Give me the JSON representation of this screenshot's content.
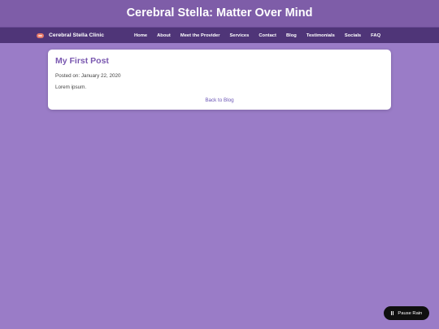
{
  "header": {
    "title": "Cerebral Stella: Matter Over Mind"
  },
  "nav": {
    "brand": "Cerebral Stella Clinic",
    "brand_icon": "brain-icon",
    "links": [
      "Home",
      "About",
      "Meet the Provider",
      "Services",
      "Contact",
      "Blog",
      "Testimonials",
      "Socials",
      "FAQ"
    ]
  },
  "post": {
    "title": "My First Post",
    "date": "Posted on: January 22, 2020",
    "body": "Lorem ipsum.",
    "back_label": "Back to Blog"
  },
  "rain_toggle": {
    "label": "Pause Rain",
    "icon": "pause-icon"
  },
  "colors": {
    "page_background": "#9a7cc7",
    "header_background": "#7e5da8",
    "nav_background": "#4f3578",
    "accent": "#7a58b0",
    "link": "#6b55b5"
  }
}
